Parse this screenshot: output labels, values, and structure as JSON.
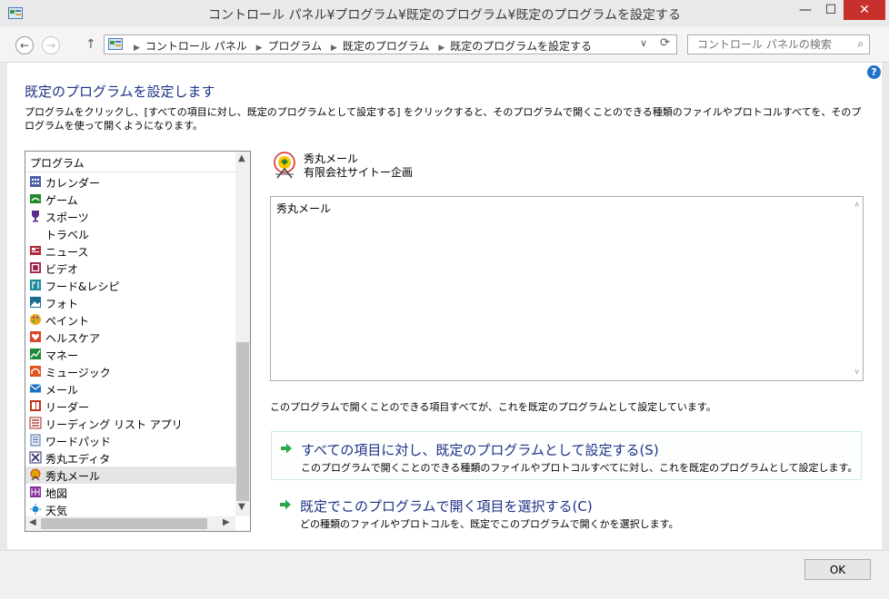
{
  "window": {
    "title": "コントロール パネル¥プログラム¥既定のプログラム¥既定のプログラムを設定する",
    "minimize": "—",
    "maximize": "☐",
    "close": "✕"
  },
  "nav": {
    "back": "←",
    "forward": "→",
    "up": "↑",
    "breadcrumbs": [
      "コントロール パネル",
      "プログラム",
      "既定のプログラム",
      "既定のプログラムを設定する"
    ],
    "search_placeholder": "コントロール パネルの検索"
  },
  "page": {
    "help": "?",
    "heading": "既定のプログラムを設定します",
    "description": "プログラムをクリックし、[すべての項目に対し、既定のプログラムとして設定する] をクリックすると、そのプログラムで開くことのできる種類のファイルやプロトコルすべてを、そのプログラムを使って開くようになります。"
  },
  "program_list": {
    "header": "プログラム",
    "items": [
      {
        "label": "カレンダー",
        "icon": "calendar-icon",
        "color": "#4a5fa8"
      },
      {
        "label": "ゲーム",
        "icon": "gamepad-icon",
        "color": "#1f8a2c"
      },
      {
        "label": "スポーツ",
        "icon": "trophy-icon",
        "color": "#5a2d8c"
      },
      {
        "label": "トラベル",
        "icon": "none",
        "color": "#ffffff"
      },
      {
        "label": "ニュース",
        "icon": "news-icon",
        "color": "#b2263a"
      },
      {
        "label": "ビデオ",
        "icon": "video-icon",
        "color": "#9c1e4a"
      },
      {
        "label": "フード&レシピ",
        "icon": "fork-knife-icon",
        "color": "#1a8a9a"
      },
      {
        "label": "フォト",
        "icon": "photo-icon",
        "color": "#1d6a93"
      },
      {
        "label": "ペイント",
        "icon": "palette-icon",
        "color": "#e2a61f"
      },
      {
        "label": "ヘルスケア",
        "icon": "heart-icon",
        "color": "#d9452a"
      },
      {
        "label": "マネー",
        "icon": "chart-up-icon",
        "color": "#1e8a3a"
      },
      {
        "label": "ミュージック",
        "icon": "headphones-icon",
        "color": "#e0541c"
      },
      {
        "label": "メール",
        "icon": "mail-icon",
        "color": "#1e6fc0"
      },
      {
        "label": "リーダー",
        "icon": "reader-icon",
        "color": "#c2351c"
      },
      {
        "label": "リーディング リスト アプリ",
        "icon": "reading-list-icon",
        "color": "#a3221e"
      },
      {
        "label": "ワードパッド",
        "icon": "wordpad-icon",
        "color": "#4a6fa8"
      },
      {
        "label": "秀丸エディタ",
        "icon": "hidemaru-editor-icon",
        "color": "#2b2b6e"
      },
      {
        "label": "秀丸メール",
        "icon": "hidemaru-mail-icon",
        "color": "#d9a700",
        "selected": true
      },
      {
        "label": "地図",
        "icon": "map-icon",
        "color": "#8a2b9a"
      },
      {
        "label": "天気",
        "icon": "weather-icon",
        "color": "#1e8ad6"
      }
    ]
  },
  "selected_program": {
    "name": "秀丸メール",
    "company": "有限会社サイトー企画",
    "description": "秀丸メール"
  },
  "status_text": "このプログラムで開くことのできる項目すべてが、これを既定のプログラムとして設定しています。",
  "commands": [
    {
      "title": "すべての項目に対し、既定のプログラムとして設定する(S)",
      "subtitle": "このプログラムで開くことのできる種類のファイルやプロトコルすべてに対し、これを既定のプログラムとして設定します。"
    },
    {
      "title": "既定でこのプログラムで開く項目を選択する(C)",
      "subtitle": "どの種類のファイルやプロトコルを、既定でこのプログラムで開くかを選択します。"
    }
  ],
  "footer": {
    "ok_label": "OK"
  },
  "colors": {
    "link_blue": "#1e3287",
    "close_red": "#c7312c",
    "arrow_green": "#2aa84a"
  }
}
